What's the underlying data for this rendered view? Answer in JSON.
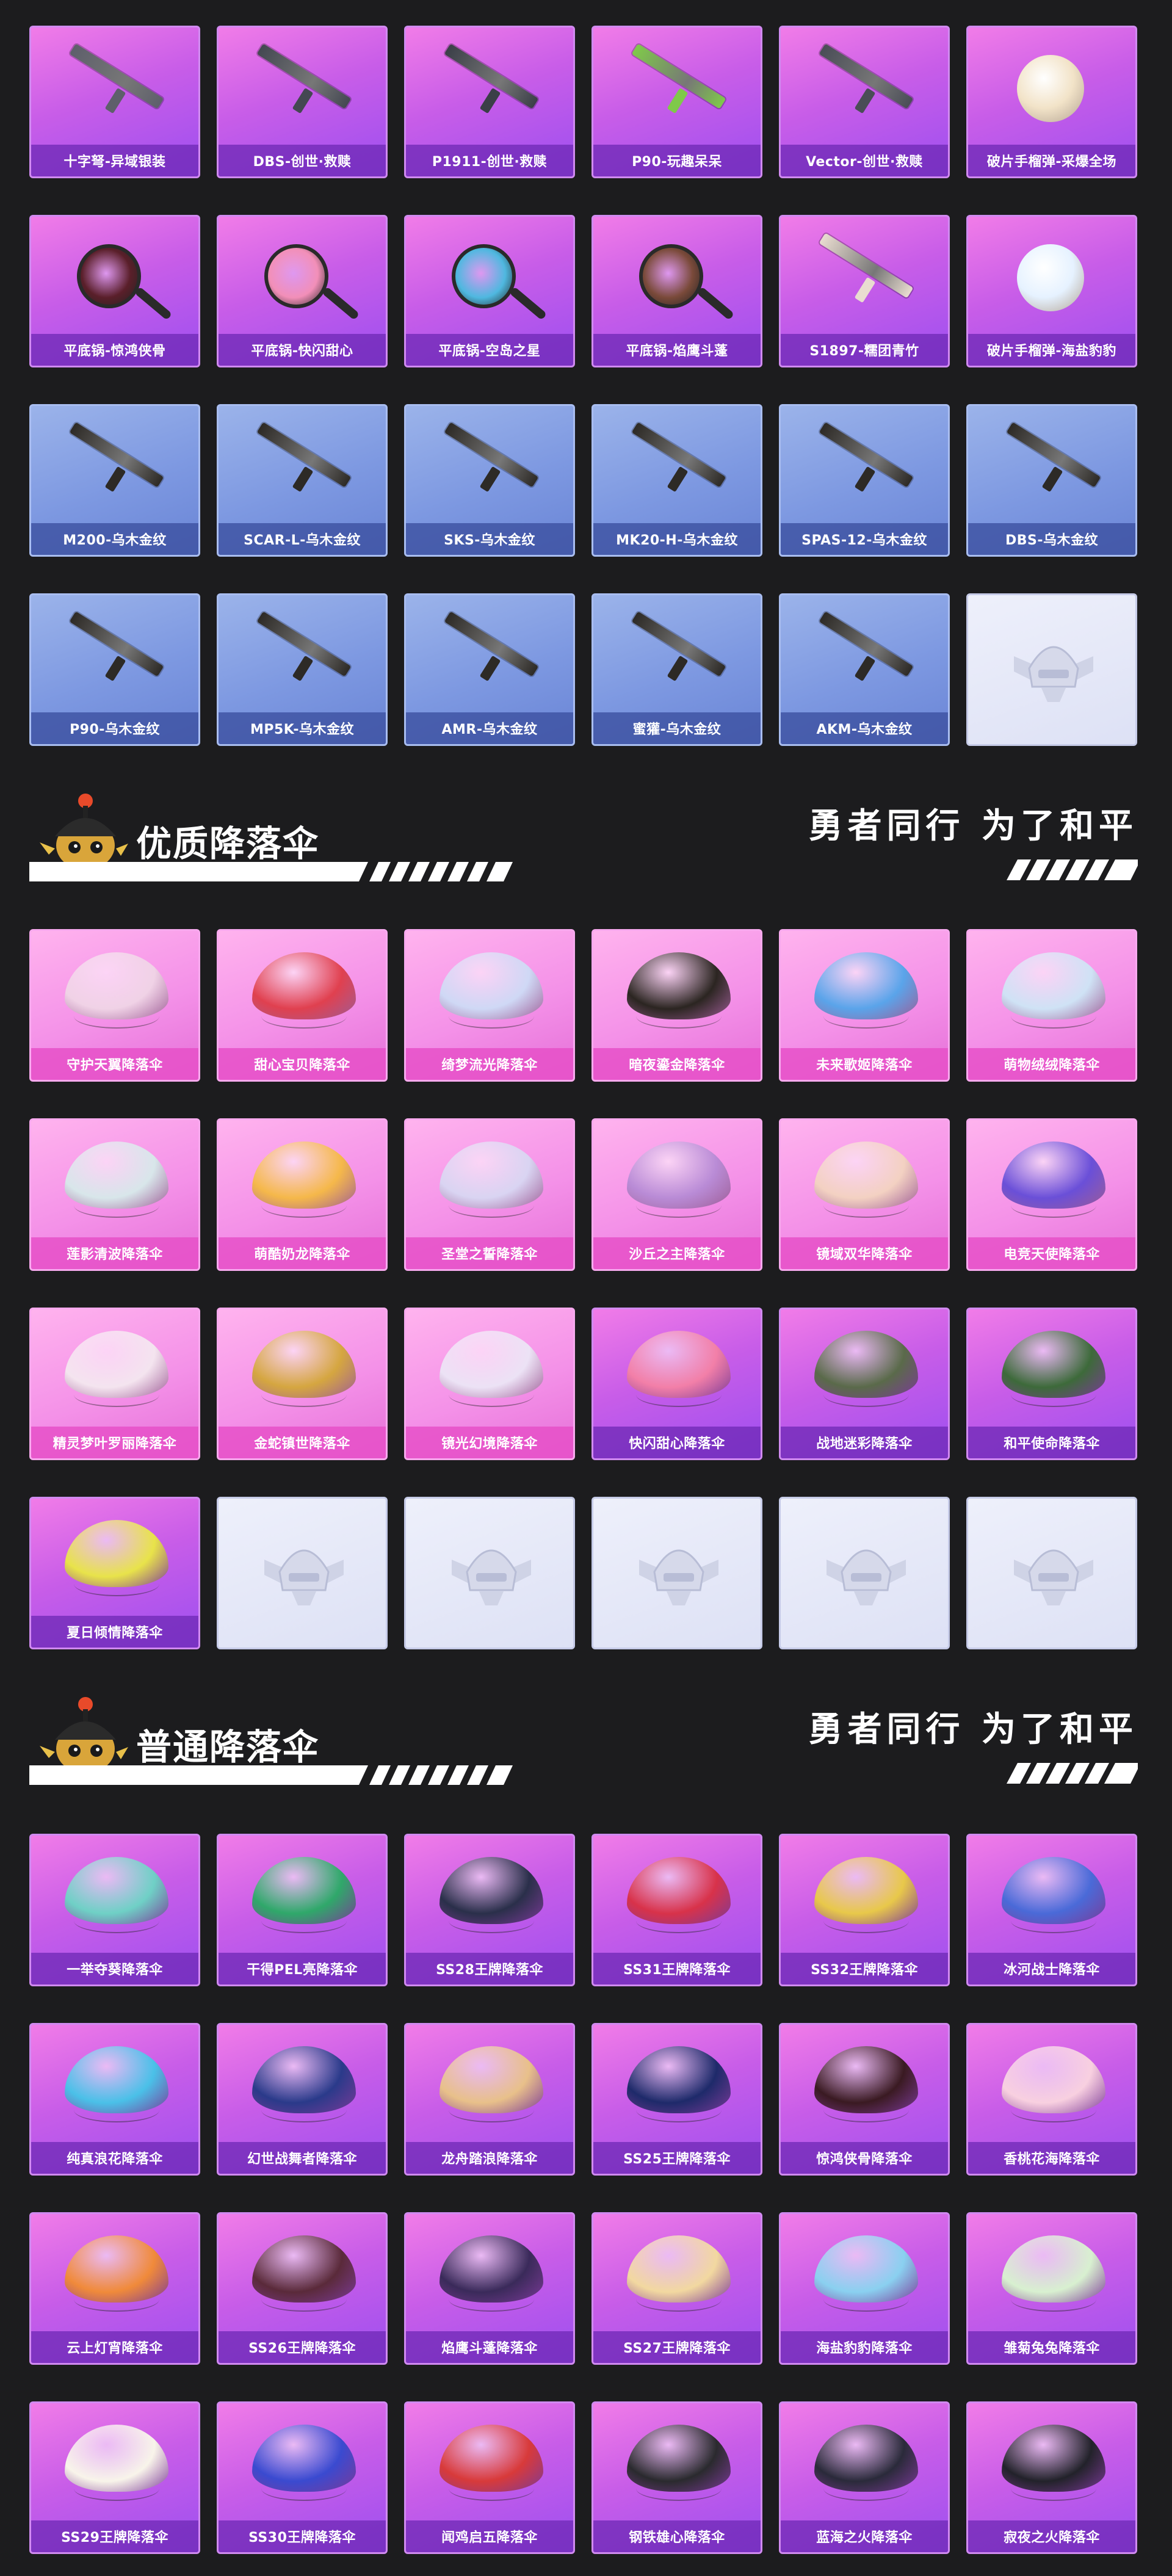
{
  "weapons": [
    {
      "label": "十字弩-异域银装",
      "theme": "purple",
      "icon": "crossbow-icon",
      "color": "#5e5f6b"
    },
    {
      "label": "DBS-创世·救赎",
      "theme": "purple",
      "icon": "shotgun-icon",
      "color": "#444852"
    },
    {
      "label": "P1911-创世·救赎",
      "theme": "purple",
      "icon": "pistol-icon",
      "color": "#3b3f48"
    },
    {
      "label": "P90-玩趣呆呆",
      "theme": "purple",
      "icon": "smg-icon",
      "color": "#7fc94a"
    },
    {
      "label": "Vector-创世·救赎",
      "theme": "purple",
      "icon": "smg-icon",
      "color": "#4a4d57"
    },
    {
      "label": "破片手榴弹-采爆全场",
      "theme": "purple",
      "icon": "grenade-icon",
      "color": "#f2e3c8"
    },
    {
      "label": "平底锅-惊鸿侠骨",
      "theme": "purple",
      "icon": "frying-pan-icon",
      "color": "#5a1f2a"
    },
    {
      "label": "平底锅-快闪甜心",
      "theme": "purple",
      "icon": "frying-pan-icon",
      "color": "#f28fb8"
    },
    {
      "label": "平底锅-空岛之星",
      "theme": "purple",
      "icon": "frying-pan-icon",
      "color": "#4fb8e0"
    },
    {
      "label": "平底锅-焰鹰斗蓬",
      "theme": "purple",
      "icon": "frying-pan-icon",
      "color": "#7a4a3a"
    },
    {
      "label": "S1897-糯团青竹",
      "theme": "purple",
      "icon": "shotgun-icon",
      "color": "#e9dcd0"
    },
    {
      "label": "破片手榴弹-海盐豹豹",
      "theme": "purple",
      "icon": "grenade-icon",
      "color": "#e6f2ff"
    },
    {
      "label": "M200-乌木金纹",
      "theme": "blue",
      "icon": "sniper-rifle-icon",
      "color": "#2d2a26"
    },
    {
      "label": "SCAR-L-乌木金纹",
      "theme": "blue",
      "icon": "assault-rifle-icon",
      "color": "#2d2a26"
    },
    {
      "label": "SKS-乌木金纹",
      "theme": "blue",
      "icon": "marksman-rifle-icon",
      "color": "#2d2a26"
    },
    {
      "label": "MK20-H-乌木金纹",
      "theme": "blue",
      "icon": "marksman-rifle-icon",
      "color": "#2d2a26"
    },
    {
      "label": "SPAS-12-乌木金纹",
      "theme": "blue",
      "icon": "shotgun-icon",
      "color": "#2d2a26"
    },
    {
      "label": "DBS-乌木金纹",
      "theme": "blue",
      "icon": "shotgun-icon",
      "color": "#2d2a26"
    },
    {
      "label": "P90-乌木金纹",
      "theme": "blue",
      "icon": "smg-icon",
      "color": "#2d2a26"
    },
    {
      "label": "MP5K-乌木金纹",
      "theme": "blue",
      "icon": "smg-icon",
      "color": "#2d2a26"
    },
    {
      "label": "AMR-乌木金纹",
      "theme": "blue",
      "icon": "sniper-rifle-icon",
      "color": "#2d2a26"
    },
    {
      "label": "蜜獾-乌木金纹",
      "theme": "blue",
      "icon": "assault-rifle-icon",
      "color": "#2d2a26"
    },
    {
      "label": "AKM-乌木金纹",
      "theme": "blue",
      "icon": "assault-rifle-icon",
      "color": "#2d2a26"
    },
    {
      "label": "",
      "theme": "empty",
      "icon": "helmet-emblem-icon",
      "color": "#c9cde0"
    }
  ],
  "quality_section": {
    "title": "优质降落伞",
    "slogan": "勇者同行 为了和平",
    "items": [
      {
        "label": "守护天翼降落伞",
        "theme": "pink",
        "icon": "parachute-icon",
        "color": "#f0d2e6"
      },
      {
        "label": "甜心宝贝降落伞",
        "theme": "pink",
        "icon": "parachute-icon",
        "color": "#e0404f"
      },
      {
        "label": "绮梦流光降落伞",
        "theme": "pink",
        "icon": "parachute-icon",
        "color": "#cfd8f5"
      },
      {
        "label": "暗夜鎏金降落伞",
        "theme": "pink",
        "icon": "parachute-icon",
        "color": "#2b2521"
      },
      {
        "label": "未来歌姬降落伞",
        "theme": "pink",
        "icon": "parachute-icon",
        "color": "#5aa4ea"
      },
      {
        "label": "萌物绒绒降落伞",
        "theme": "pink",
        "icon": "parachute-icon",
        "color": "#cfe2f5"
      },
      {
        "label": "莲影清波降落伞",
        "theme": "pink",
        "icon": "parachute-icon",
        "color": "#d8e6ea"
      },
      {
        "label": "萌酷奶龙降落伞",
        "theme": "pink",
        "icon": "parachute-icon",
        "color": "#f5b84a"
      },
      {
        "label": "圣堂之誓降落伞",
        "theme": "pink",
        "icon": "parachute-icon",
        "color": "#d9d4f2"
      },
      {
        "label": "沙丘之主降落伞",
        "theme": "pink",
        "icon": "parachute-icon",
        "color": "#b98bd6"
      },
      {
        "label": "镜域双华降落伞",
        "theme": "pink",
        "icon": "parachute-icon",
        "color": "#f3d1c2"
      },
      {
        "label": "电竞天使降落伞",
        "theme": "pink",
        "icon": "parachute-icon",
        "color": "#6a4fd8"
      },
      {
        "label": "精灵梦叶罗丽降落伞",
        "theme": "pink",
        "icon": "parachute-icon",
        "color": "#f4e4ef"
      },
      {
        "label": "金蛇镇世降落伞",
        "theme": "pink",
        "icon": "parachute-icon",
        "color": "#d5a640"
      },
      {
        "label": "镜光幻境降落伞",
        "theme": "pink",
        "icon": "parachute-icon",
        "color": "#ece2f5"
      },
      {
        "label": "快闪甜心降落伞",
        "theme": "purple",
        "icon": "parachute-icon",
        "color": "#f27fa8"
      },
      {
        "label": "战地迷彩降落伞",
        "theme": "purple",
        "icon": "parachute-icon",
        "color": "#5a6a4a"
      },
      {
        "label": "和平使命降落伞",
        "theme": "purple",
        "icon": "parachute-icon",
        "color": "#3d6a3a"
      },
      {
        "label": "夏日倾情降落伞",
        "theme": "purple",
        "icon": "parachute-icon",
        "color": "#e8e34a"
      },
      {
        "label": "",
        "theme": "empty",
        "icon": "helmet-emblem-icon",
        "color": "#c9cde0"
      },
      {
        "label": "",
        "theme": "empty",
        "icon": "helmet-emblem-icon",
        "color": "#c9cde0"
      },
      {
        "label": "",
        "theme": "empty",
        "icon": "helmet-emblem-icon",
        "color": "#c9cde0"
      },
      {
        "label": "",
        "theme": "empty",
        "icon": "helmet-emblem-icon",
        "color": "#c9cde0"
      },
      {
        "label": "",
        "theme": "empty",
        "icon": "helmet-emblem-icon",
        "color": "#c9cde0"
      }
    ]
  },
  "normal_section": {
    "title": "普通降落伞",
    "slogan": "勇者同行 为了和平",
    "items": [
      {
        "label": "一举夺葵降落伞",
        "theme": "purple",
        "icon": "parachute-icon",
        "color": "#6fd0c6"
      },
      {
        "label": "干得PEL亮降落伞",
        "theme": "purple",
        "icon": "parachute-icon",
        "color": "#2fa86a"
      },
      {
        "label": "SS28王牌降落伞",
        "theme": "purple",
        "icon": "parachute-icon",
        "color": "#2a2f4a"
      },
      {
        "label": "SS31王牌降落伞",
        "theme": "purple",
        "icon": "parachute-icon",
        "color": "#d8324a"
      },
      {
        "label": "SS32王牌降落伞",
        "theme": "purple",
        "icon": "parachute-icon",
        "color": "#e8c84a"
      },
      {
        "label": "冰河战士降落伞",
        "theme": "purple",
        "icon": "parachute-icon",
        "color": "#4a6ad8"
      },
      {
        "label": "纯真浪花降落伞",
        "theme": "purple",
        "icon": "parachute-icon",
        "color": "#4ac0e8"
      },
      {
        "label": "幻世战舞者降落伞",
        "theme": "purple",
        "icon": "parachute-icon",
        "color": "#2a3a8a"
      },
      {
        "label": "龙舟踏浪降落伞",
        "theme": "purple",
        "icon": "parachute-icon",
        "color": "#e8c08a"
      },
      {
        "label": "SS25王牌降落伞",
        "theme": "purple",
        "icon": "parachute-icon",
        "color": "#1e2a6a"
      },
      {
        "label": "惊鸿侠骨降落伞",
        "theme": "purple",
        "icon": "parachute-icon",
        "color": "#3a1a22"
      },
      {
        "label": "香桃花海降落伞",
        "theme": "purple",
        "icon": "parachute-icon",
        "color": "#f8d0e0"
      },
      {
        "label": "云上灯宵降落伞",
        "theme": "purple",
        "icon": "parachute-icon",
        "color": "#f08a3a"
      },
      {
        "label": "SS26王牌降落伞",
        "theme": "purple",
        "icon": "parachute-icon",
        "color": "#5a2a3a"
      },
      {
        "label": "焰鹰斗蓬降落伞",
        "theme": "purple",
        "icon": "parachute-icon",
        "color": "#3a2a5a"
      },
      {
        "label": "SS27王牌降落伞",
        "theme": "purple",
        "icon": "parachute-icon",
        "color": "#f2d8a0"
      },
      {
        "label": "海盐豹豹降落伞",
        "theme": "purple",
        "icon": "parachute-icon",
        "color": "#8ad0f0"
      },
      {
        "label": "雏菊兔兔降落伞",
        "theme": "purple",
        "icon": "parachute-icon",
        "color": "#d8f0d0"
      },
      {
        "label": "SS29王牌降落伞",
        "theme": "purple",
        "icon": "parachute-icon",
        "color": "#f8f4ea"
      },
      {
        "label": "SS30王牌降落伞",
        "theme": "purple",
        "icon": "parachute-icon",
        "color": "#3a4ad0"
      },
      {
        "label": "闻鸡启五降落伞",
        "theme": "purple",
        "icon": "parachute-icon",
        "color": "#d83a3a"
      },
      {
        "label": "钢铁雄心降落伞",
        "theme": "purple",
        "icon": "parachute-icon",
        "color": "#2a2a2e"
      },
      {
        "label": "蓝海之火降落伞",
        "theme": "purple",
        "icon": "parachute-icon",
        "color": "#2a2a3a"
      },
      {
        "label": "寂夜之火降落伞",
        "theme": "purple",
        "icon": "parachute-icon",
        "color": "#22222a"
      }
    ]
  }
}
